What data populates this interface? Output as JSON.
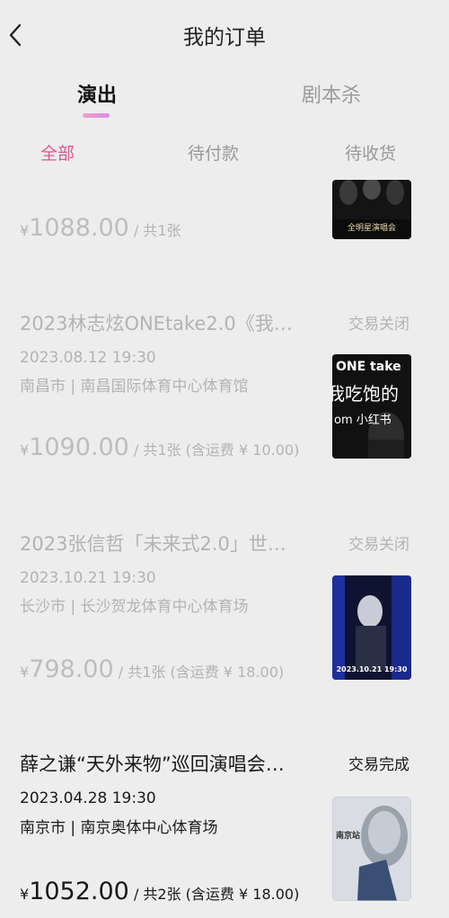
{
  "header": {
    "title": "我的订单"
  },
  "category_tabs": [
    "演出",
    "剧本杀"
  ],
  "status_tabs": [
    "全部",
    "待付款",
    "待收货"
  ],
  "orders": [
    {
      "price_yen": "¥",
      "price_amount": "1088.00",
      "quantity_text": "/ 共1张",
      "poster_text": "全明星演唱会"
    },
    {
      "title": "2023林志炫ONEtake2.0《我…",
      "status": "交易关闭",
      "datetime": "2023.08.12 19:30",
      "venue": "南昌市 | 南昌国际体育中心体育馆",
      "price_yen": "¥",
      "price_amount": "1090.00",
      "quantity_text": "/ 共1张 (含运费 ¥ 10.00)",
      "poster_text_1": "ONE take",
      "poster_text_2": "我吃饱的",
      "poster_text_3": "om 小红书"
    },
    {
      "title": "2023张信哲「未来式2.0」世…",
      "status": "交易关闭",
      "datetime": "2023.10.21 19:30",
      "venue": "长沙市 | 长沙贺龙体育中心体育场",
      "price_yen": "¥",
      "price_amount": "798.00",
      "quantity_text": "/ 共1张 (含运费 ¥ 18.00)",
      "poster_text": "2023.10.21 19:30"
    },
    {
      "title": "薛之谦“天外来物”巡回演唱会…",
      "status": "交易完成",
      "datetime": "2023.04.28 19:30",
      "venue": "南京市 | 南京奥体中心体育场",
      "price_yen": "¥",
      "price_amount": "1052.00",
      "quantity_text": "/ 共2张 (含运费 ¥ 18.00)",
      "poster_text": "南京站"
    }
  ],
  "colors": {
    "background": "#ededed",
    "accent_pink": "#e2558f",
    "closed_text": "#b3b3b3",
    "primary_text": "#1a1a1a"
  }
}
